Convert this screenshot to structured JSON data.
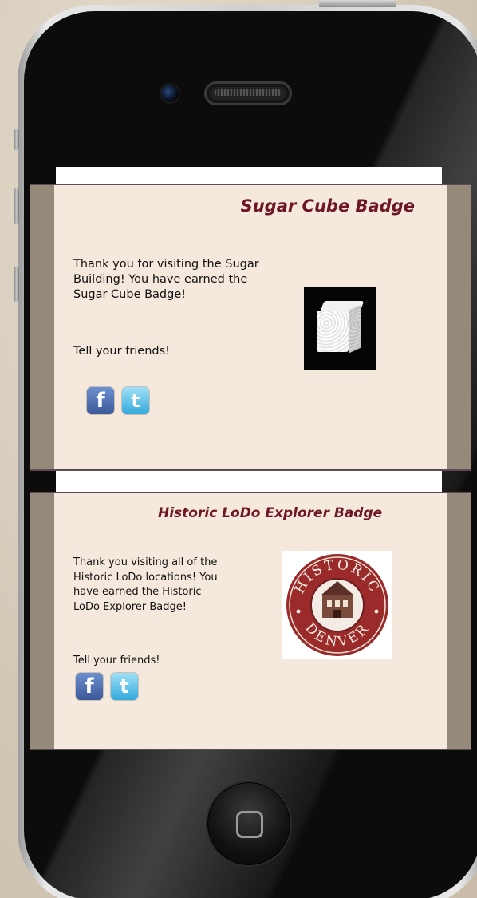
{
  "cards": [
    {
      "title": "Sugar Cube Badge",
      "message": "Thank you for visiting the Sugar Building! You have earned the Sugar Cube Badge!",
      "share_prompt": "Tell your friends!",
      "facebook_glyph": "f",
      "twitter_glyph": "t",
      "image": "sugar-cube"
    },
    {
      "title": "Historic LoDo Explorer Badge",
      "message": "Thank you visiting all of the Historic LoDo locations! You have earned the Historic LoDo Explorer Badge!",
      "share_prompt": "Tell your friends!",
      "facebook_glyph": "f",
      "twitter_glyph": "t",
      "image": "historic-denver-seal",
      "seal_text_top": "HISTORIC",
      "seal_text_bottom": "DENVER"
    }
  ],
  "colors": {
    "title": "#6e1626",
    "card_bg": "#f4e9dc",
    "seal_red": "#9b2a2a",
    "facebook": "#3b5998",
    "twitter": "#33aadd"
  }
}
